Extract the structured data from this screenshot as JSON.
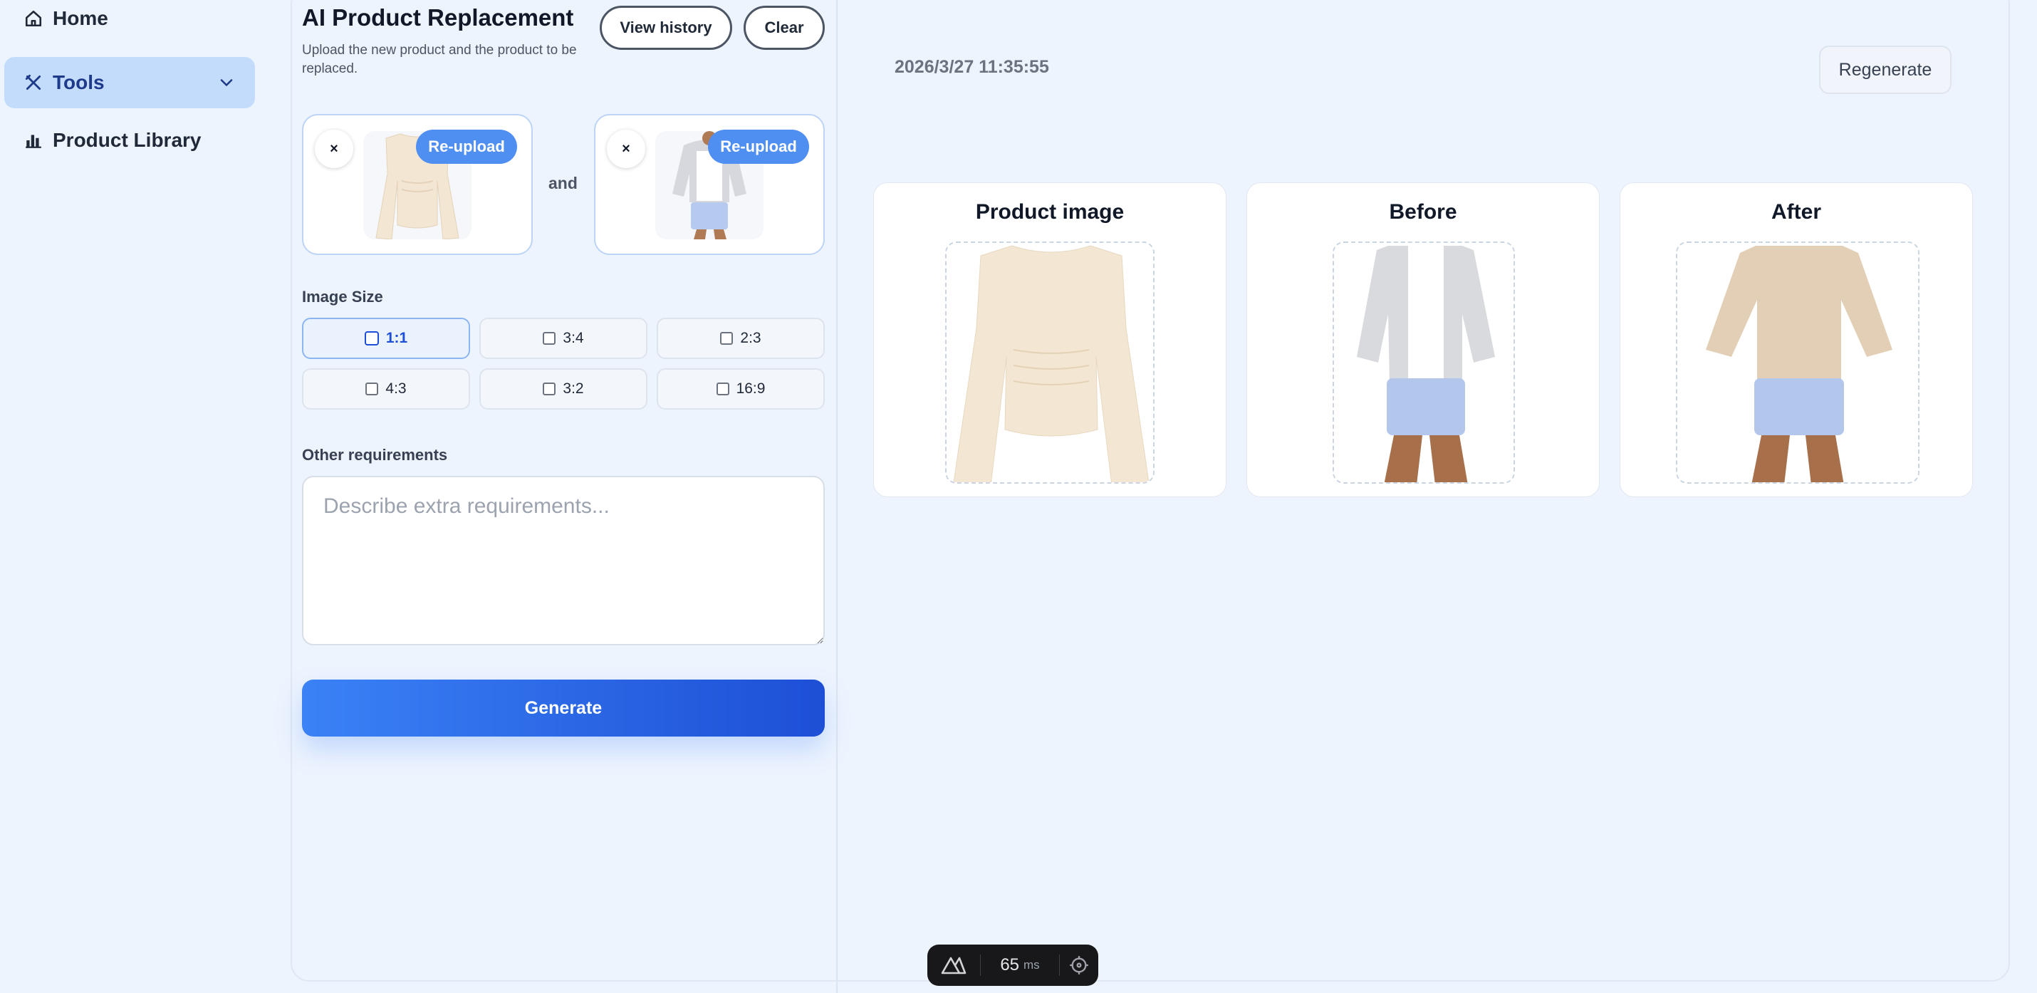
{
  "sidebar": {
    "items": [
      {
        "label": "Home",
        "icon": "home-icon"
      },
      {
        "label": "Tools",
        "icon": "tools-icon",
        "active": true,
        "expand_icon": "chevron-down-icon"
      },
      {
        "label": "Product Library",
        "icon": "bar-chart-icon"
      }
    ]
  },
  "panel": {
    "title": "AI Product Replacement",
    "subtitle": "Upload the new product and the product to be replaced.",
    "history_label": "View history",
    "clear_label": "Clear",
    "uploads": [
      {
        "remove_label": "×",
        "reupload_label": "Re-upload",
        "image": "cream-long-sleeve-top"
      },
      {
        "remove_label": "×",
        "reupload_label": "Re-upload",
        "image": "model-grey-cardigan-blue-shorts"
      }
    ],
    "and_label": "and",
    "image_size_label": "Image Size",
    "sizes": [
      {
        "label": "1:1",
        "selected": true
      },
      {
        "label": "3:4",
        "selected": false
      },
      {
        "label": "2:3",
        "selected": false
      },
      {
        "label": "4:3",
        "selected": false
      },
      {
        "label": "3:2",
        "selected": false
      },
      {
        "label": "16:9",
        "selected": false
      }
    ],
    "requirements_label": "Other requirements",
    "requirements_placeholder": "Describe extra requirements...",
    "requirements_value": "",
    "generate_label": "Generate"
  },
  "result": {
    "timestamp": "2026/3/27 11:35:55",
    "regenerate_label": "Regenerate",
    "cards": [
      {
        "title": "Product image",
        "image": "cream-long-sleeve-top"
      },
      {
        "title": "Before",
        "image": "model-grey-cardigan-blue-shorts"
      },
      {
        "title": "After",
        "image": "model-cream-top-blue-shorts"
      }
    ]
  },
  "devtools": {
    "logo_icon": "nuxt-icon",
    "render_time": "65",
    "render_unit": "ms",
    "inspect_icon": "crosshair-icon"
  },
  "colors": {
    "background": "#eef4fe",
    "accent": "#3b82f6",
    "accent_dark": "#1d4fd6",
    "active_nav": "#c4dcfb",
    "reupload_badge": "#4f8ff2"
  }
}
